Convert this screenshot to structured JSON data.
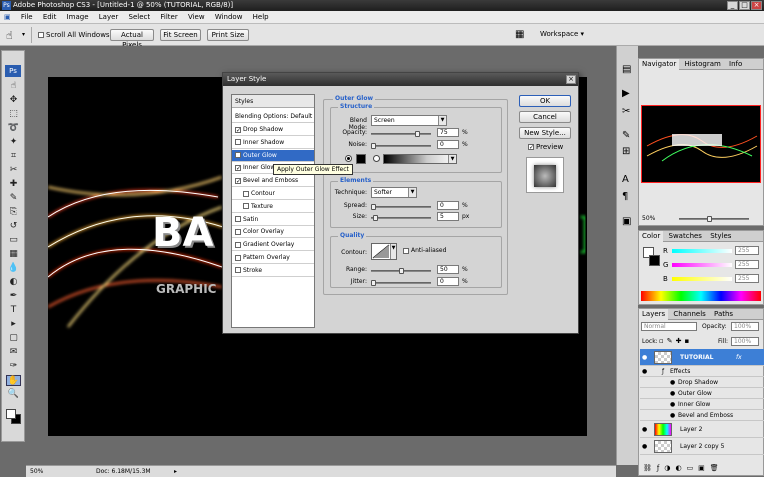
{
  "app": {
    "title": "Adobe Photoshop CS3 - [Untitled-1 @ 50% (TUTORIAL, RGB/8)]",
    "ps_badge": "Ps"
  },
  "window_buttons": {
    "minimize": "_",
    "restore": "□",
    "close": "×"
  },
  "menu": [
    "File",
    "Edit",
    "Image",
    "Layer",
    "Select",
    "Filter",
    "View",
    "Window",
    "Help"
  ],
  "options": {
    "scroll_all": "Scroll All Windows",
    "actual_pixels": "Actual Pixels",
    "fit_screen": "Fit Screen",
    "print_size": "Print Size",
    "workspace": "Workspace ▾"
  },
  "tools": [
    "hand-icon",
    "move-icon",
    "marquee-icon",
    "lasso-icon",
    "magic-wand-icon",
    "crop-icon",
    "slice-icon",
    "healing-icon",
    "brush-icon",
    "stamp-icon",
    "history-brush-icon",
    "eraser-icon",
    "gradient-icon",
    "blur-icon",
    "dodge-icon",
    "pen-icon",
    "type-icon",
    "path-select-icon",
    "shape-icon",
    "notes-icon",
    "eyedropper-icon",
    "hand-tool-icon",
    "zoom-icon"
  ],
  "status": {
    "zoom": "50%",
    "doc": "Doc: 6.18M/15.3M"
  },
  "canvas_text": {
    "main": "BA",
    "sub": "GRAPHIC"
  },
  "dialog": {
    "title": "Layer Style",
    "styles_header": "Styles",
    "blending_options": "Blending Options: Default",
    "styles": [
      {
        "label": "Drop Shadow",
        "checked": true
      },
      {
        "label": "Inner Shadow",
        "checked": false
      },
      {
        "label": "Outer Glow",
        "checked": true,
        "selected": true
      },
      {
        "label": "Inner Glow",
        "checked": true
      },
      {
        "label": "Bevel and Emboss",
        "checked": true
      },
      {
        "label": "Contour",
        "checked": false,
        "sub": true
      },
      {
        "label": "Texture",
        "checked": false,
        "sub": true
      },
      {
        "label": "Satin",
        "checked": false
      },
      {
        "label": "Color Overlay",
        "checked": false
      },
      {
        "label": "Gradient Overlay",
        "checked": false
      },
      {
        "label": "Pattern Overlay",
        "checked": false
      },
      {
        "label": "Stroke",
        "checked": false
      }
    ],
    "tooltip": "Apply Outer Glow Effect",
    "section_title": "Outer Glow",
    "structure": {
      "title": "Structure",
      "blend_mode_label": "Blend Mode:",
      "blend_mode": "Screen",
      "opacity_label": "Opacity:",
      "opacity": "75",
      "noise_label": "Noise:",
      "noise": "0",
      "pct": "%"
    },
    "elements": {
      "title": "Elements",
      "technique_label": "Technique:",
      "technique": "Softer",
      "spread_label": "Spread:",
      "spread": "0",
      "size_label": "Size:",
      "size": "5",
      "pct": "%",
      "px": "px"
    },
    "quality": {
      "title": "Quality",
      "contour_label": "Contour:",
      "antialiased": "Anti-aliased",
      "range_label": "Range:",
      "range": "50",
      "jitter_label": "Jitter:",
      "jitter": "0",
      "pct": "%"
    },
    "buttons": {
      "ok": "OK",
      "cancel": "Cancel",
      "new_style": "New Style...",
      "preview": "Preview"
    }
  },
  "navigator": {
    "tabs": [
      "Navigator",
      "Histogram",
      "Info"
    ],
    "zoom": "50%"
  },
  "color": {
    "tabs": [
      "Color",
      "Swatches",
      "Styles"
    ],
    "channels": [
      {
        "label": "R",
        "value": "255"
      },
      {
        "label": "G",
        "value": "255"
      },
      {
        "label": "B",
        "value": "255"
      }
    ]
  },
  "layers": {
    "tabs": [
      "Layers",
      "Channels",
      "Paths"
    ],
    "blend": "Normal",
    "opacity_label": "Opacity:",
    "opacity": "100%",
    "lock_label": "Lock:",
    "fill_label": "Fill:",
    "fill": "100%",
    "rows": [
      {
        "name": "TUTORIAL",
        "fx": "fx",
        "selected": true
      },
      {
        "name": "Effects",
        "effect": true,
        "indent": 1
      },
      {
        "name": "Drop Shadow",
        "effect": true,
        "indent": 2
      },
      {
        "name": "Outer Glow",
        "effect": true,
        "indent": 2
      },
      {
        "name": "Inner Glow",
        "effect": true,
        "indent": 2
      },
      {
        "name": "Bevel and Emboss",
        "effect": true,
        "indent": 2
      },
      {
        "name": "Layer 2",
        "thumb": "rainbow"
      },
      {
        "name": "Layer 2 copy 5",
        "thumb": "blank"
      }
    ]
  }
}
